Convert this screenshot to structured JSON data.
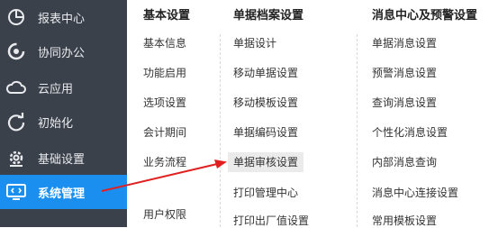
{
  "sidebar": {
    "items": [
      {
        "label": "报表中心",
        "icon": "pie-chart-icon"
      },
      {
        "label": "协同办公",
        "icon": "collaboration-icon"
      },
      {
        "label": "云应用",
        "icon": "cloud-icon"
      },
      {
        "label": "初始化",
        "icon": "refresh-icon"
      },
      {
        "label": "基础设置",
        "icon": "gear-icon"
      },
      {
        "label": "系统管理",
        "icon": "monitor-code-icon"
      }
    ],
    "active_color": "#1b8ff0",
    "bg_color": "#3b414b"
  },
  "columns": {
    "basic": {
      "title": "基本设置",
      "items": [
        "基本信息",
        "功能启用",
        "选项设置",
        "会计期间",
        "业务流程",
        "用户权限"
      ]
    },
    "docs": {
      "title": "单据档案设置",
      "items": [
        "单据设计",
        "移动单据设置",
        "移动模板设置",
        "单据编码设置",
        "单据审核设置",
        "打印管理中心",
        "打印出厂值设置"
      ]
    },
    "msg": {
      "title": "消息中心及预警设置",
      "items": [
        "单据消息设置",
        "预警消息设置",
        "查询消息设置",
        "个性化消息设置",
        "内部消息查询",
        "消息中心连接设置",
        "常用模板设置"
      ]
    }
  },
  "annotation": {
    "arrow_color": "#e02020"
  }
}
